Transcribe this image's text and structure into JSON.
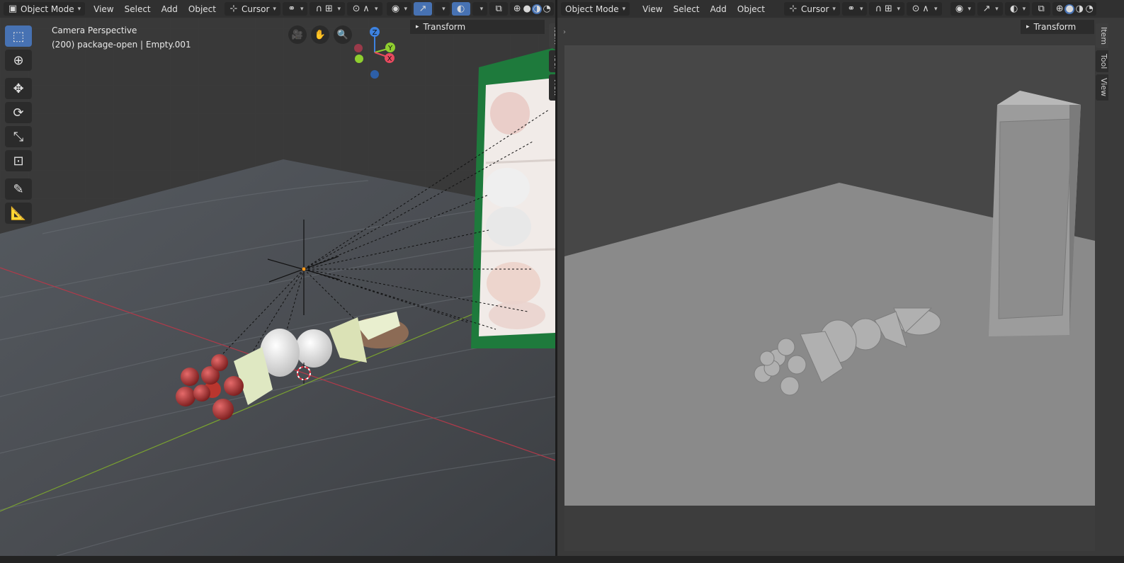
{
  "left_editor": {
    "header": {
      "mode": "Object Mode",
      "menus": [
        "View",
        "Select",
        "Add",
        "Object"
      ],
      "pivot": "Cursor"
    },
    "overlay": {
      "camera_label": "Camera Perspective",
      "object_label": "(200) package-open | Empty.001"
    },
    "gizmo_axes": {
      "z": "Z",
      "y": "Y",
      "x": "X"
    },
    "npanel": {
      "title": "Transform"
    },
    "side_tabs": [
      "Item",
      "Tool",
      "View"
    ]
  },
  "right_editor": {
    "header": {
      "mode": "Object Mode",
      "menus": [
        "View",
        "Select",
        "Add",
        "Object"
      ],
      "pivot": "Cursor"
    },
    "npanel": {
      "title": "Transform"
    },
    "side_tabs": [
      "Item",
      "Tool",
      "View"
    ]
  },
  "colors": {
    "accent": "#4772b3",
    "axis_x": "#e84a5f",
    "axis_y": "#8fcf2f",
    "axis_z": "#3d82e0",
    "package_green": "#1e7a3c"
  },
  "icons": {
    "tools": [
      "select-box-icon",
      "cursor-icon",
      "move-icon",
      "rotate-icon",
      "scale-icon",
      "transform-icon",
      "annotate-icon",
      "measure-icon"
    ],
    "nav": [
      "camera-view-icon",
      "hand-pan-icon",
      "zoom-icon"
    ]
  }
}
